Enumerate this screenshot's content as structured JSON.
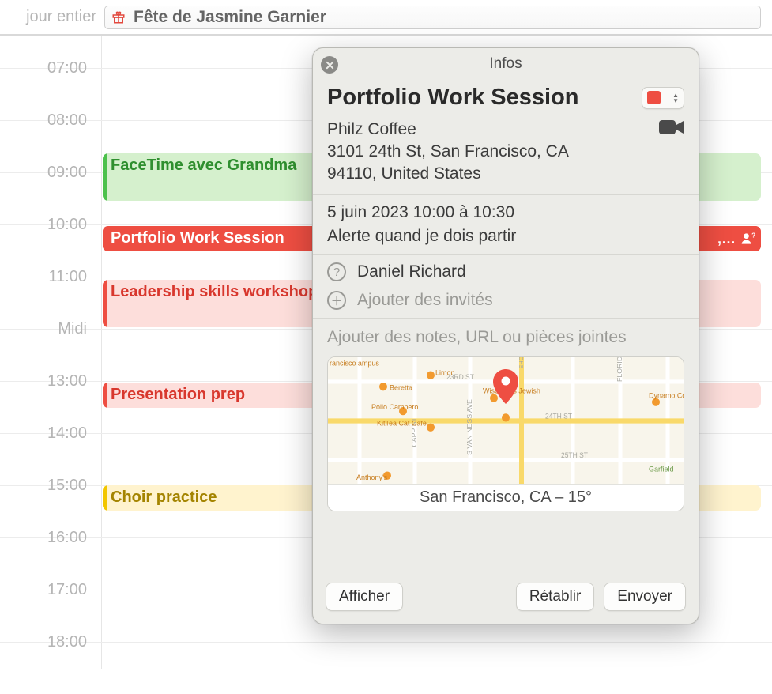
{
  "allday": {
    "label": "jour entier",
    "event_title": "Fête de Jasmine Garnier"
  },
  "hours": [
    "07:00",
    "08:00",
    "09:00",
    "10:00",
    "11:00",
    "Midi",
    "13:00",
    "14:00",
    "15:00",
    "16:00",
    "17:00",
    "18:00"
  ],
  "events": {
    "grandma": {
      "title": "FaceTime avec Grandma"
    },
    "portfolio": {
      "title": "Portfolio Work Session",
      "badge_more": ",…"
    },
    "leadership": {
      "title": "Leadership skills workshop"
    },
    "presentation": {
      "title": "Presentation prep"
    },
    "choir": {
      "title": "Choir practice"
    }
  },
  "popover": {
    "tab": "Infos",
    "title": "Portfolio Work Session",
    "calendar_color": "#ee4e42",
    "location": {
      "name": "Philz Coffee",
      "addr1": "3101 24th St, San Francisco, CA",
      "addr2": "94110, United States"
    },
    "datetime": "5 juin 2023  10:00 à 10:30",
    "alert_text": "Alerte quand je dois partir",
    "invitee": "Daniel Richard",
    "add_invitee_placeholder": "Ajouter des invités",
    "notes_placeholder": "Ajouter des notes, URL ou pièces jointes",
    "map_footer": "San Francisco, CA – 15°",
    "map_labels": {
      "street23": "23RD ST",
      "street24": "24TH ST",
      "street25": "25TH ST",
      "capp": "CAPP ST",
      "svn": "S VAN NESS AVE",
      "shotwell": "SHOTWELL ST",
      "florida": "FLORIDA ST",
      "campus": "rancisco ampus",
      "beretta": "Beretta",
      "pollo": "Pollo Campero",
      "kittea": "KitTea Cat Cafe",
      "wise": "Wise Sons Jewish",
      "dynamo": "Dynamo Coffee",
      "anthony": "Anthony's",
      "garfield": "Garfield",
      "limon": "Limon"
    },
    "buttons": {
      "show": "Afficher",
      "revert": "Rétablir",
      "send": "Envoyer"
    }
  }
}
